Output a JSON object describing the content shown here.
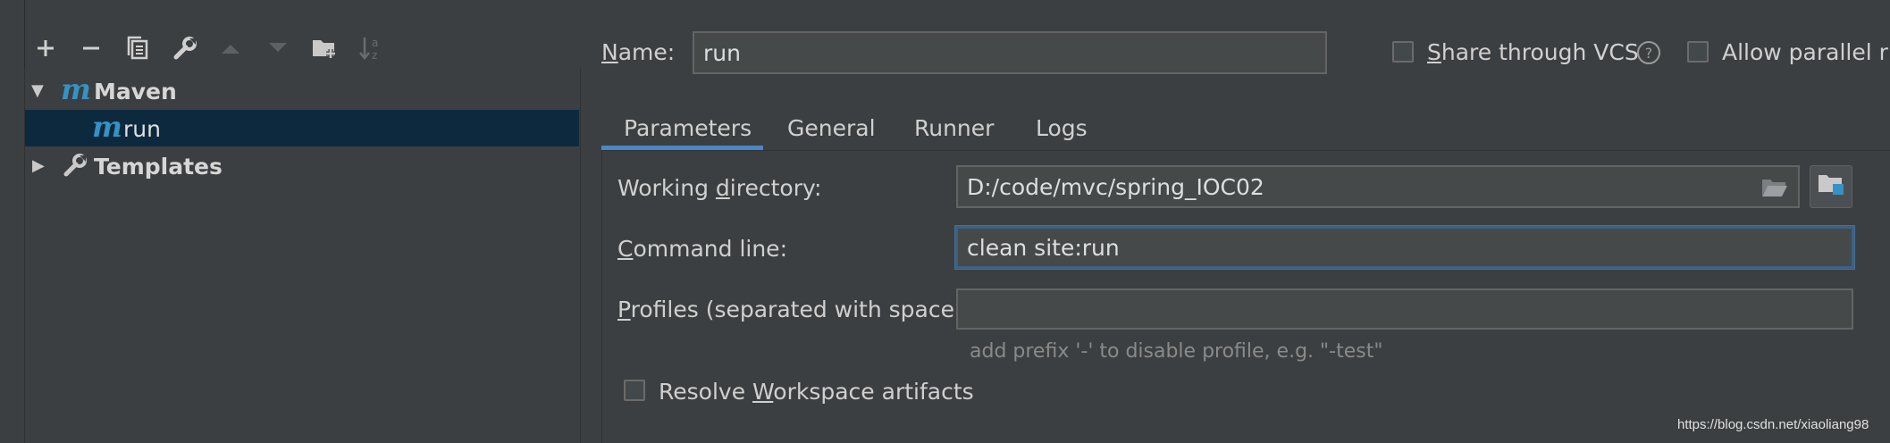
{
  "toolbar": {
    "icons": [
      "add-icon",
      "remove-icon",
      "copy-icon",
      "wrench-icon",
      "move-up-icon",
      "move-down-icon",
      "new-folder-icon",
      "sort-icon"
    ]
  },
  "tree": {
    "items": [
      {
        "label": "Maven",
        "icon": "maven-icon",
        "expanded": true
      },
      {
        "label": "run",
        "icon": "maven-icon",
        "selected": true
      },
      {
        "label": "Templates",
        "icon": "wrench-icon",
        "expanded": false
      }
    ]
  },
  "header": {
    "name_label_prefix": "",
    "name_label_u": "N",
    "name_label_rest": "ame:",
    "name_value": "run",
    "share_vcs_u": "S",
    "share_vcs_rest": "hare through VCS",
    "parallel_label": "Allow parallel run"
  },
  "tabs": [
    {
      "label": "Parameters",
      "active": true
    },
    {
      "label": "General",
      "active": false
    },
    {
      "label": "Runner",
      "active": false
    },
    {
      "label": "Logs",
      "active": false
    }
  ],
  "params": {
    "working_dir_pre": "Working ",
    "working_dir_u": "d",
    "working_dir_post": "irectory:",
    "working_dir_value": "D:/code/mvc/spring_IOC02",
    "command_u": "C",
    "command_rest": "ommand line:",
    "command_value": "clean site:run",
    "profiles_u": "P",
    "profiles_rest": "rofiles (separated with space):",
    "profiles_value": "",
    "profiles_hint": "add prefix '-' to disable profile, e.g. \"-test\"",
    "resolve_pre": "Resolve ",
    "resolve_u": "W",
    "resolve_post": "orkspace artifacts"
  },
  "watermark": "https://blog.csdn.net/xiaoliang98"
}
